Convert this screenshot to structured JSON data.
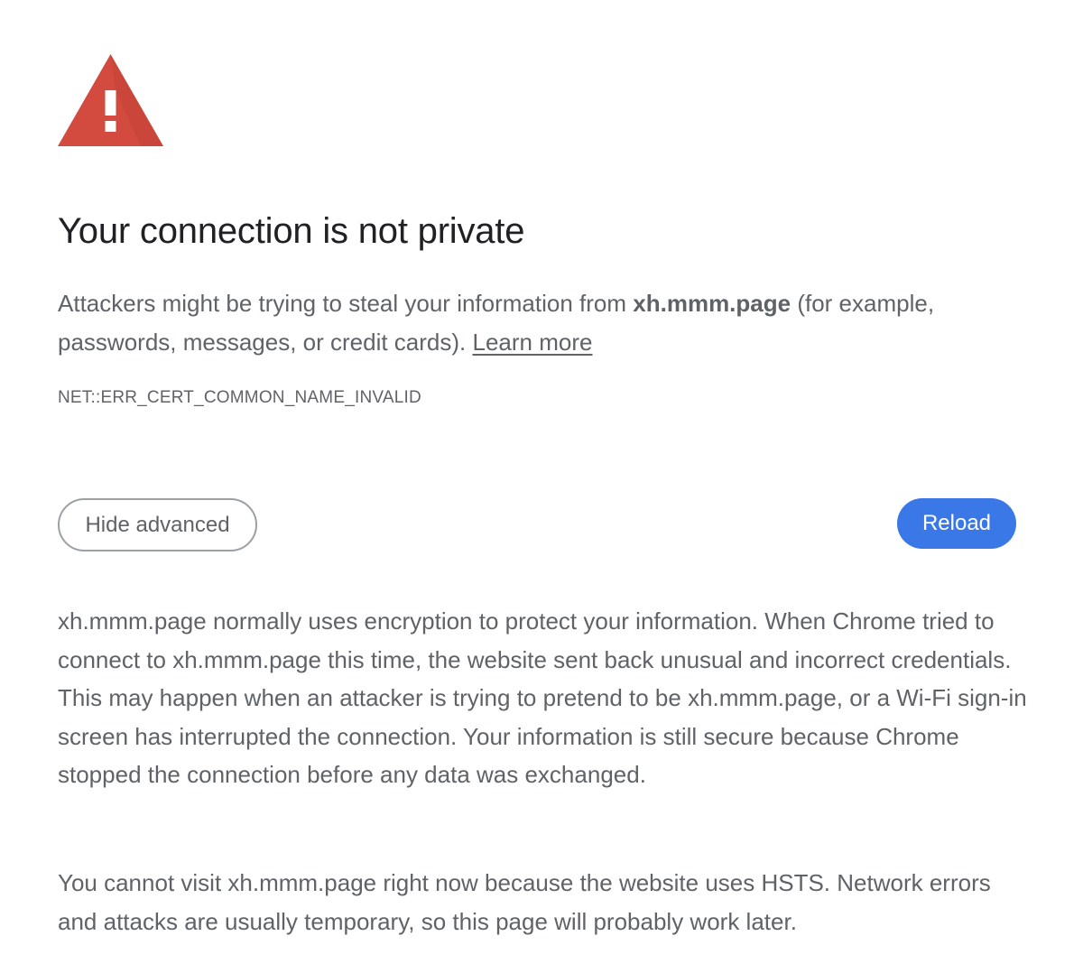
{
  "heading": "Your connection is not private",
  "intro": {
    "before_host": "Attackers might be trying to steal your information from ",
    "host": "xh.mmm.page",
    "after_host": " (for example, passwords, messages, or credit cards). ",
    "learn_more": "Learn more"
  },
  "error_code": "NET::ERR_CERT_COMMON_NAME_INVALID",
  "buttons": {
    "hide_advanced": "Hide advanced",
    "reload": "Reload"
  },
  "details": "xh.mmm.page normally uses encryption to protect your information. When Chrome tried to connect to xh.mmm.page this time, the website sent back unusual and incorrect credentials. This may happen when an attacker is trying to pretend to be xh.mmm.page, or a Wi-Fi sign-in screen has interrupted the connection. Your information is still secure because Chrome stopped the connection before any data was exchanged.",
  "hsts_notice": "You cannot visit xh.mmm.page right now because the website uses HSTS. Network errors and attacks are usually temporary, so this page will probably work later.",
  "icons": {
    "warning": "warning-triangle-icon"
  },
  "colors": {
    "warning_red": "#d24b3e",
    "reload_blue": "#3b78e7",
    "heading_text": "#202124",
    "body_text": "#5f6368"
  }
}
